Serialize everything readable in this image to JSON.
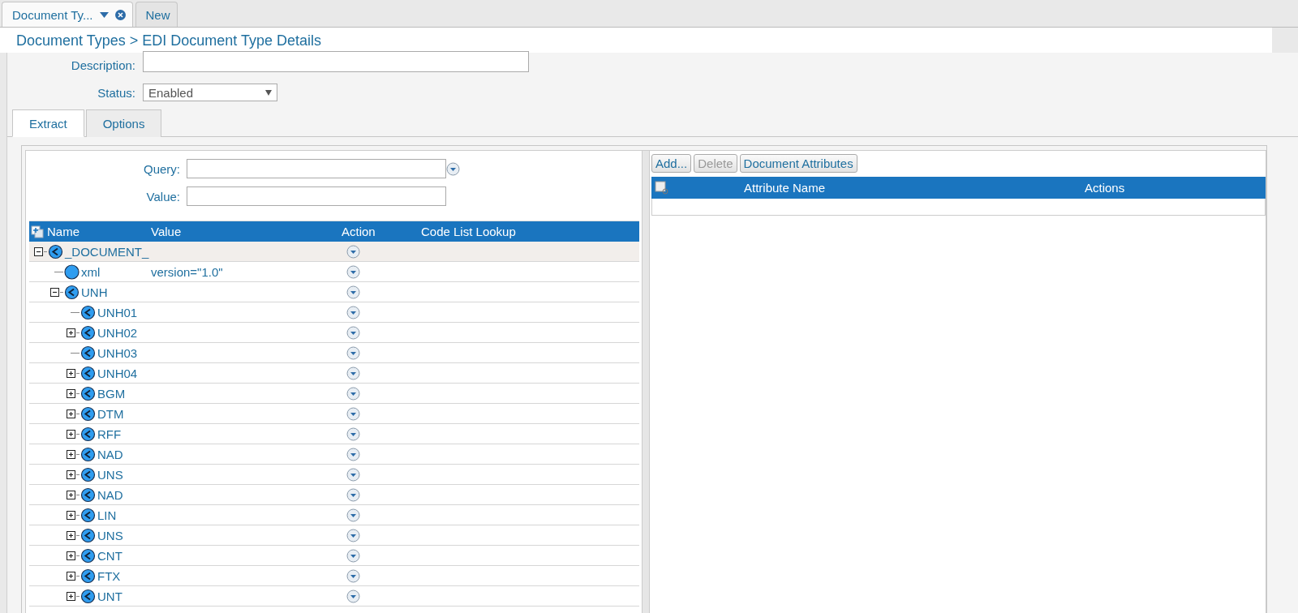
{
  "doc_tabs": [
    {
      "label": "Document Ty...",
      "selected": true,
      "closable": true
    },
    {
      "label": "New",
      "selected": false,
      "closable": false
    }
  ],
  "breadcrumb": "Document Types > EDI Document Type Details",
  "form": {
    "description_label": "Description:",
    "status_label": "Status:",
    "status_value": "Enabled"
  },
  "tabs": [
    {
      "label": "Extract",
      "selected": true
    },
    {
      "label": "Options",
      "selected": false
    }
  ],
  "query": {
    "query_label": "Query:",
    "value_label": "Value:"
  },
  "tree_columns": [
    "Name",
    "Value",
    "Action",
    "Code List Lookup"
  ],
  "tree": [
    {
      "name": "_DOCUMENT_",
      "kind": "element",
      "selected": true,
      "expanded": true,
      "children": [
        {
          "name": "xml",
          "kind": "declaration",
          "selected": false,
          "value": "version=\"1.0\""
        },
        {
          "name": "UNH",
          "kind": "element",
          "selected": false,
          "expanded": true,
          "children": [
            {
              "name": "UNH01",
              "kind": "element",
              "selected": false
            },
            {
              "name": "UNH02",
              "kind": "element",
              "selected": false,
              "expanded": false
            },
            {
              "name": "UNH03",
              "kind": "element",
              "selected": false
            },
            {
              "name": "UNH04",
              "kind": "element",
              "selected": false,
              "expanded": false
            },
            {
              "name": "BGM",
              "kind": "element",
              "selected": false,
              "expanded": false
            },
            {
              "name": "DTM",
              "kind": "element",
              "selected": false,
              "expanded": false
            },
            {
              "name": "RFF",
              "kind": "element",
              "selected": false,
              "expanded": false
            },
            {
              "name": "NAD",
              "kind": "element",
              "selected": false,
              "expanded": false
            },
            {
              "name": "UNS",
              "kind": "element",
              "selected": false,
              "expanded": false
            },
            {
              "name": "NAD",
              "kind": "element",
              "selected": false,
              "expanded": false
            },
            {
              "name": "LIN",
              "kind": "element",
              "selected": false,
              "expanded": false
            },
            {
              "name": "UNS",
              "kind": "element",
              "selected": false,
              "expanded": false
            },
            {
              "name": "CNT",
              "kind": "element",
              "selected": false,
              "expanded": false
            },
            {
              "name": "FTX",
              "kind": "element",
              "selected": false,
              "expanded": false
            },
            {
              "name": "UNT",
              "kind": "element",
              "selected": false,
              "expanded": false
            }
          ]
        }
      ]
    }
  ],
  "attr_buttons": [
    {
      "label": "Add...",
      "disabled": false
    },
    {
      "label": "Delete",
      "disabled": true
    },
    {
      "label": "Document Attributes",
      "disabled": false
    }
  ],
  "attr_columns": [
    "Attribute Name",
    "Actions"
  ]
}
